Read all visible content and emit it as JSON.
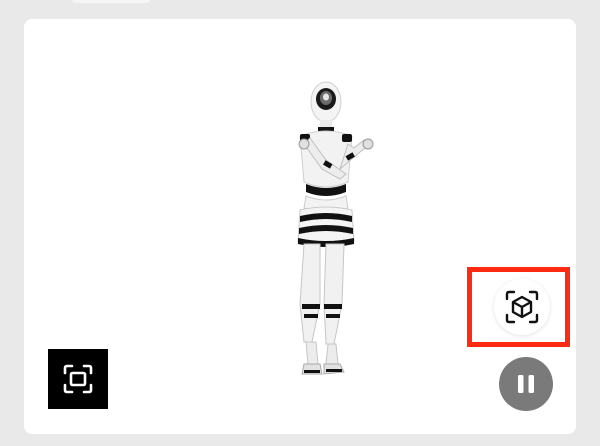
{
  "viewer": {
    "model_description": "",
    "controls": {
      "fullscreen_icon": "fullscreen-frame-icon",
      "ar_icon": "ar-cube-icon",
      "pause_icon": "pause-icon"
    },
    "colors": {
      "highlight": "#ff2a12",
      "fullscreen_bg": "#000000",
      "pause_bg": "#7a7a7a"
    }
  }
}
